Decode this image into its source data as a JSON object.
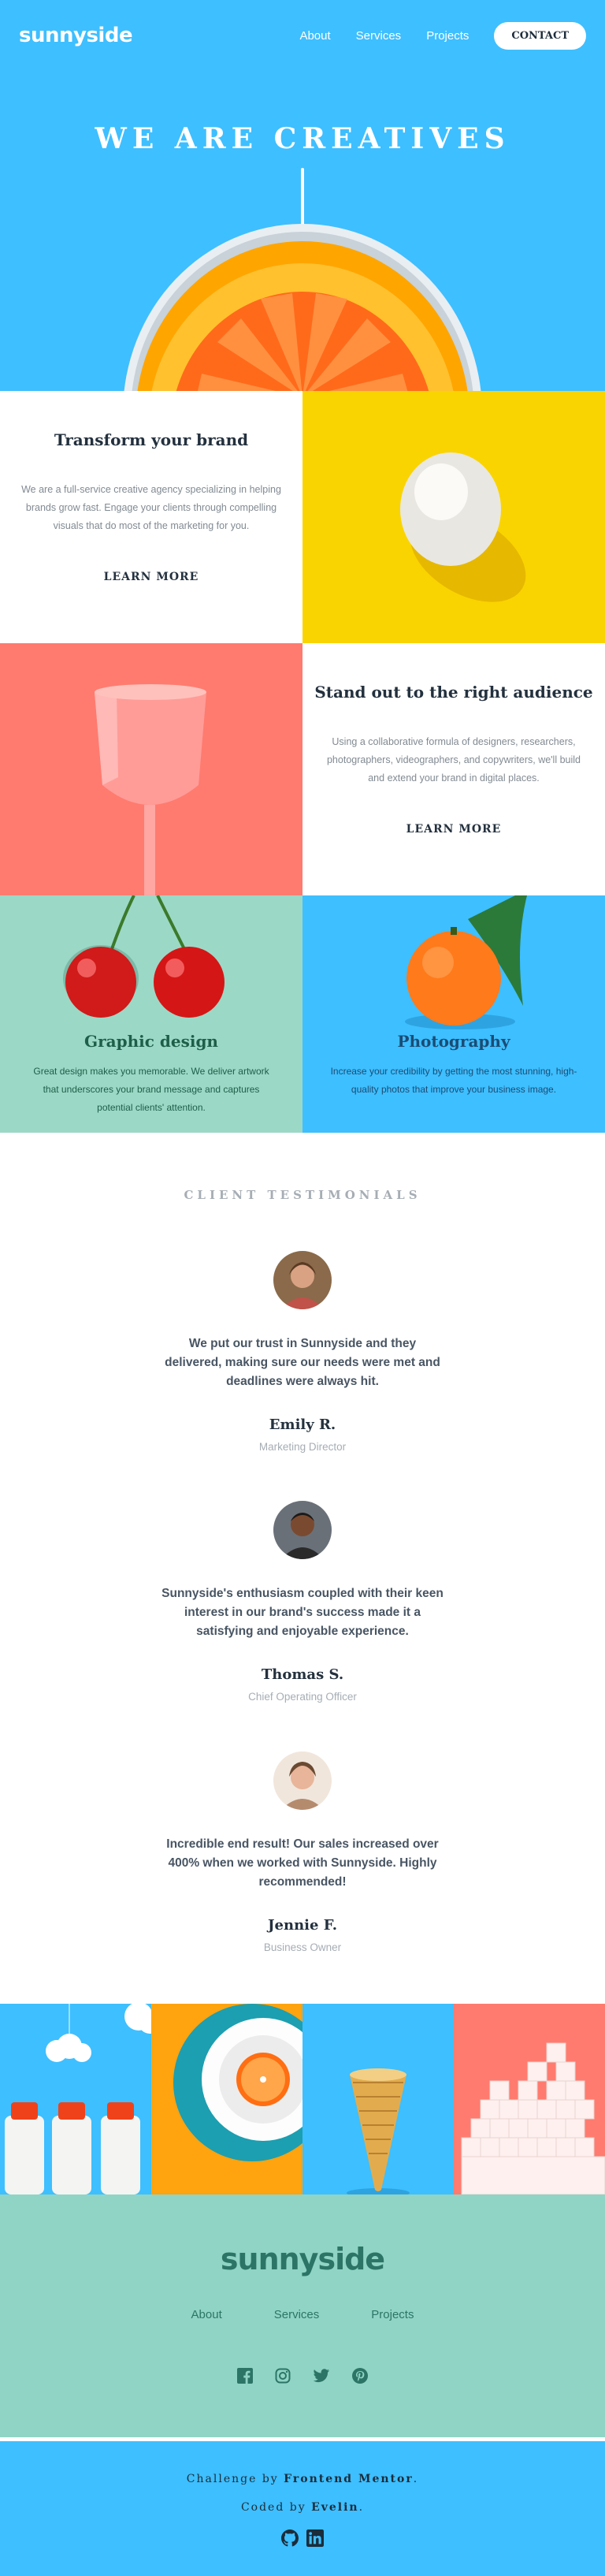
{
  "header": {
    "logo": "sunnyside",
    "nav": [
      {
        "label": "About"
      },
      {
        "label": "Services"
      },
      {
        "label": "Projects"
      }
    ],
    "contact_label": "CONTACT",
    "hero_title": "WE ARE CREATIVES"
  },
  "features": [
    {
      "title": "Transform your brand",
      "text": "We are a full-service creative agency specializing in helping brands grow fast. Engage your clients through compelling visuals that do most of the marketing for you.",
      "link": "LEARN MORE",
      "accent": "#fad400"
    },
    {
      "title": "Stand out to the right audience",
      "text": "Using a collaborative formula of designers, researchers, photographers, videographers, and copywriters, we'll build and extend your brand in digital places.",
      "link": "LEARN MORE",
      "accent": "#ff7b6f"
    }
  ],
  "services": [
    {
      "title": "Graphic design",
      "text": "Great design makes you memorable. We deliver artwork that underscores your brand message and captures potential clients' attention.",
      "color": "#1d5f49"
    },
    {
      "title": "Photography",
      "text": "Increase your credibility by getting the most stunning, high-quality photos that improve your business image.",
      "color": "#1b4c75"
    }
  ],
  "testimonials": {
    "heading": "CLIENT TESTIMONIALS",
    "items": [
      {
        "quote": "We put our trust in Sunnyside and they delivered, making sure our needs were met and deadlines were always hit.",
        "name": "Emily R.",
        "role": "Marketing Director"
      },
      {
        "quote": "Sunnyside's enthusiasm coupled with their keen interest in our brand's success made it a satisfying and enjoyable experience.",
        "name": "Thomas S.",
        "role": "Chief Operating Officer"
      },
      {
        "quote": "Incredible end result! Our sales increased over 400% when we worked with Sunnyside. Highly recommended!",
        "name": "Jennie F.",
        "role": "Business Owner"
      }
    ]
  },
  "footer": {
    "logo": "sunnyside",
    "nav": [
      {
        "label": "About"
      },
      {
        "label": "Services"
      },
      {
        "label": "Projects"
      }
    ],
    "social_icons": [
      "facebook-icon",
      "instagram-icon",
      "twitter-icon",
      "pinterest-icon"
    ]
  },
  "attribution": {
    "challenge_prefix": "Challenge by",
    "challenge_name": "Frontend Mentor",
    "coded_prefix": "Coded by",
    "coded_name": "Evelin",
    "icons": [
      "github-icon",
      "linkedin-icon"
    ]
  },
  "colors": {
    "hero_bg": "#3ebfff",
    "yellow": "#fad400",
    "coral": "#ff7b6f",
    "mint": "#90d4c5",
    "dark": "#23303e"
  }
}
